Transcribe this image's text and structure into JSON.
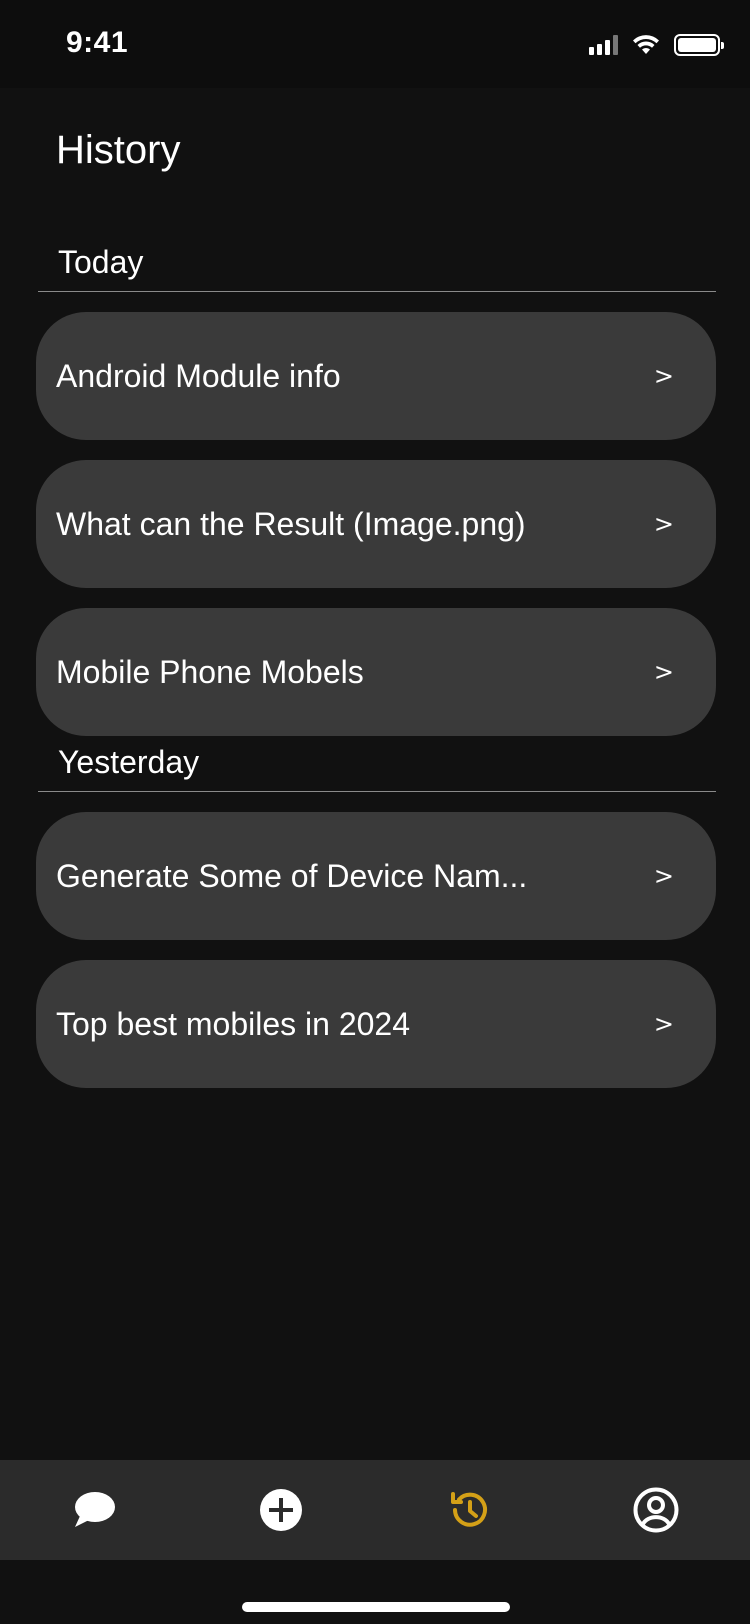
{
  "status": {
    "time": "9:41"
  },
  "page": {
    "title": "History"
  },
  "sections": [
    {
      "label": "Today",
      "items": [
        {
          "title": "Android Module info",
          "chevron": ">"
        },
        {
          "title": "What can the Result (Image.png)",
          "chevron": ">"
        },
        {
          "title": "Mobile Phone Mobels",
          "chevron": ">"
        }
      ]
    },
    {
      "label": "Yesterday",
      "items": [
        {
          "title": "Generate Some of Device Nam...",
          "chevron": ">"
        },
        {
          "title": "Top best mobiles in 2024",
          "chevron": ">"
        }
      ]
    }
  ],
  "tabbar": {
    "tabs": [
      {
        "icon": "chat-bubble-icon",
        "color": "#ffffff"
      },
      {
        "icon": "plus-circle-icon",
        "color": "#ffffff"
      },
      {
        "icon": "history-icon",
        "color": "#d4a017",
        "active": true
      },
      {
        "icon": "profile-icon",
        "color": "#ffffff"
      }
    ]
  },
  "colors": {
    "background": "#111111",
    "card": "#3a3a3a",
    "accent": "#d4a017",
    "tabbar": "#2b2b2b"
  }
}
